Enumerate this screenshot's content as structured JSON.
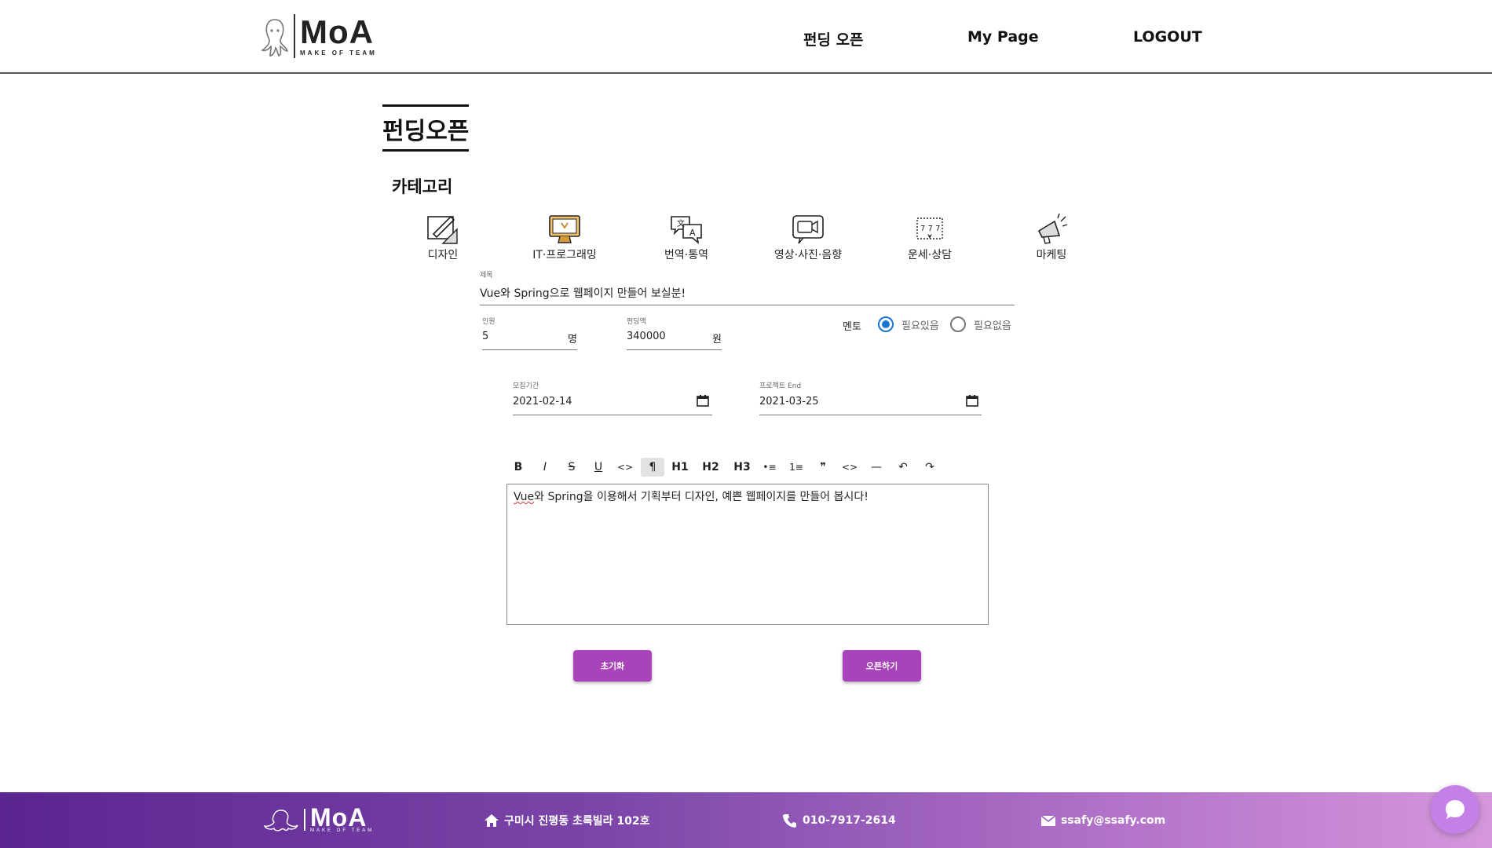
{
  "header": {
    "logo_text": "MoA",
    "logo_sub": "MAKE OF TEAM",
    "nav": [
      {
        "label": "펀딩 오픈"
      },
      {
        "label": "My Page"
      },
      {
        "label": "LOGOUT"
      }
    ]
  },
  "page_title": "펀딩오픈",
  "category_label": "카테고리",
  "categories": [
    {
      "label": "디자인",
      "icon": "design-icon"
    },
    {
      "label": "IT·프로그래밍",
      "icon": "monitor-icon"
    },
    {
      "label": "번역·통역",
      "icon": "translate-icon"
    },
    {
      "label": "영상·사진·음향",
      "icon": "video-icon"
    },
    {
      "label": "운세·상담",
      "icon": "fortune-icon"
    },
    {
      "label": "마케팅",
      "icon": "megaphone-icon"
    }
  ],
  "form": {
    "title": {
      "label": "제목",
      "value": "Vue와 Spring으로 웹페이지 만들어 보실분!"
    },
    "people": {
      "label": "인원",
      "value": "5",
      "suffix": "명"
    },
    "amount": {
      "label": "펀딩액",
      "value": "340000",
      "suffix": "원"
    },
    "mento": {
      "label": "멘토",
      "options": [
        {
          "label": "필요있음",
          "selected": true
        },
        {
          "label": "필요없음",
          "selected": false
        }
      ]
    },
    "recruit_period": {
      "label": "모집기간",
      "value": "2021-02-14"
    },
    "project_end": {
      "label": "프로젝트 End",
      "value": "2021-03-25"
    }
  },
  "toolbar": {
    "buttons": [
      {
        "glyph": "B",
        "name": "bold"
      },
      {
        "glyph": "I",
        "name": "italic"
      },
      {
        "glyph": "S",
        "name": "strike"
      },
      {
        "glyph": "U",
        "name": "underline"
      },
      {
        "glyph": "<>",
        "name": "code"
      },
      {
        "glyph": "¶",
        "name": "paragraph"
      },
      {
        "glyph": "H1",
        "name": "h1"
      },
      {
        "glyph": "H2",
        "name": "h2"
      },
      {
        "glyph": "H3",
        "name": "h3"
      },
      {
        "glyph": "•≡",
        "name": "bullet-list"
      },
      {
        "glyph": "1≡",
        "name": "ordered-list"
      },
      {
        "glyph": "❞",
        "name": "quote"
      },
      {
        "glyph": "<>",
        "name": "code-block"
      },
      {
        "glyph": "—",
        "name": "horizontal-rule"
      },
      {
        "glyph": "↶",
        "name": "undo"
      },
      {
        "glyph": "↷",
        "name": "redo"
      }
    ]
  },
  "editor": {
    "text_start": "Vue",
    "text_rest": "와 Spring을 이용해서 기획부터 디자인, 예쁜 웹페이지를 만들어 봅시다!"
  },
  "buttons": {
    "reset": "초기화",
    "open": "오픈하기"
  },
  "footer": {
    "logo_text": "MoA",
    "logo_sub": "MAKE OF TEAM",
    "address": "구미시 진평동 초록빌라 102호",
    "phone": "010-7917-2614",
    "email": "ssafy@ssafy.com"
  },
  "colors": {
    "accent": "#a843b9",
    "radio": "#1976d2",
    "footer_start": "#5a2590",
    "footer_end": "#d597dc"
  }
}
